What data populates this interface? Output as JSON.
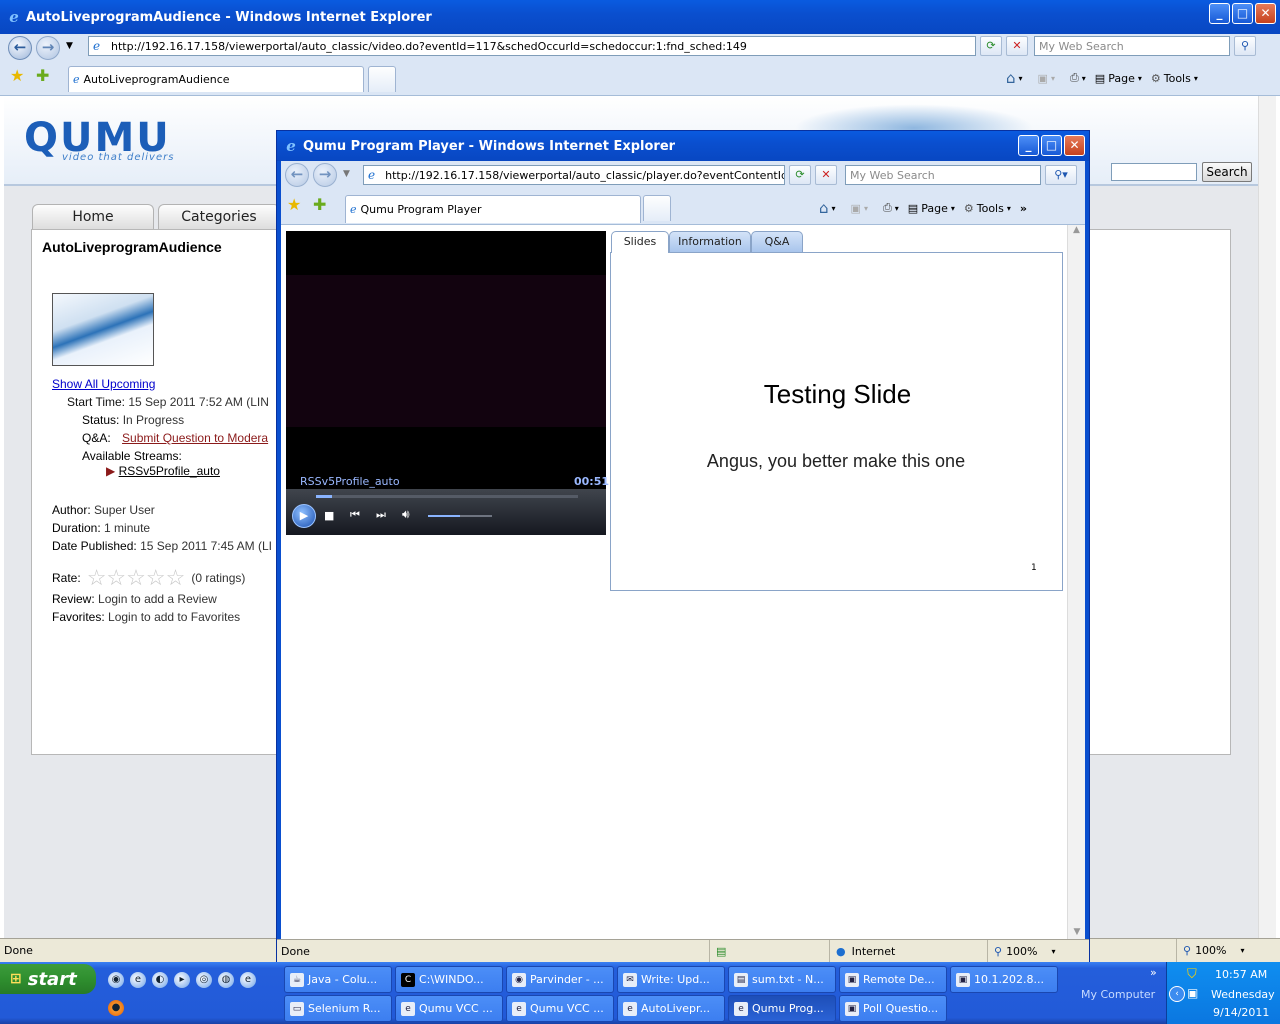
{
  "main_window": {
    "title": "AutoLiveprogramAudience - Windows Internet Explorer",
    "address": "http://192.16.17.158/viewerportal/auto_classic/video.do?eventId=117&schedOccurId=schedoccur:1:fnd_sched:149",
    "search_placeholder": "My Web Search",
    "tab_label": "AutoLiveprogramAudience",
    "cmd_page": "Page",
    "cmd_tools": "Tools",
    "status_text": "Done",
    "zoom": "100%"
  },
  "qumu_page": {
    "logo": "QUMU",
    "logo_tagline": "video that delivers",
    "search_button": "Search",
    "tabs": [
      "Home",
      "Categories"
    ],
    "program_title": "AutoLiveprogramAudience",
    "show_all_upcoming": "Show All Upcoming",
    "start_time_label": "Start Time:",
    "start_time_value": "15 Sep 2011 7:52 AM (LIN",
    "status_label": "Status:",
    "status_value": "In Progress",
    "qa_label": "Q&A:",
    "qa_link": "Submit Question to Modera",
    "streams_label": "Available Streams:",
    "stream_name": "RSSv5Profile_auto",
    "author_label": "Author:",
    "author_value": "Super User",
    "duration_label": "Duration:",
    "duration_value": "1 minute",
    "date_label": "Date Published:",
    "date_value": "15 Sep 2011 7:45 AM (LI",
    "rate_label": "Rate:",
    "rating_text": "(0 ratings)",
    "rating_value": 0,
    "rating_max": 5,
    "review_label": "Review:",
    "review_value": "Login to add a Review",
    "favorites_label": "Favorites:",
    "favorites_value": "Login to add to Favorites"
  },
  "player_window": {
    "title": "Qumu Program Player - Windows Internet Explorer",
    "address": "http://192.16.17.158/viewerportal/auto_classic/player.do?eventContentId=32",
    "search_placeholder": "My Web Search",
    "tab_label": "Qumu Program Player",
    "cmd_page": "Page",
    "cmd_tools": "Tools",
    "status_text": "Done",
    "status_zone": "Internet",
    "zoom": "100%",
    "video_stream": "RSSv5Profile_auto",
    "video_time": "00:51",
    "playback_progress": 0.06,
    "volume_level": 0.5,
    "tabs": [
      "Slides",
      "Information",
      "Q&A"
    ],
    "slide_title": "Testing Slide",
    "slide_body": "Angus, you better make this one",
    "slide_number": "1"
  },
  "taskbar": {
    "start_label": "start",
    "row1": [
      "Java - Colu...",
      "C:\\WINDO...",
      "Parvinder - ...",
      "Write: Upd...",
      "sum.txt - N...",
      "Remote De...",
      "10.1.202.8..."
    ],
    "row2": [
      "Selenium R...",
      "Qumu VCC ...",
      "Qumu VCC ...",
      "AutoLivepr...",
      "Qumu Prog...",
      "Poll Questio..."
    ],
    "my_computer": "My Computer",
    "time": "10:57 AM",
    "day": "Wednesday",
    "date": "9/14/2011"
  },
  "colors": {
    "xp_blue": "#245edb",
    "qumu_blue": "#1c5eb8",
    "link_dark_red": "#8b1a1a",
    "start_green": "#2f8f2f"
  }
}
